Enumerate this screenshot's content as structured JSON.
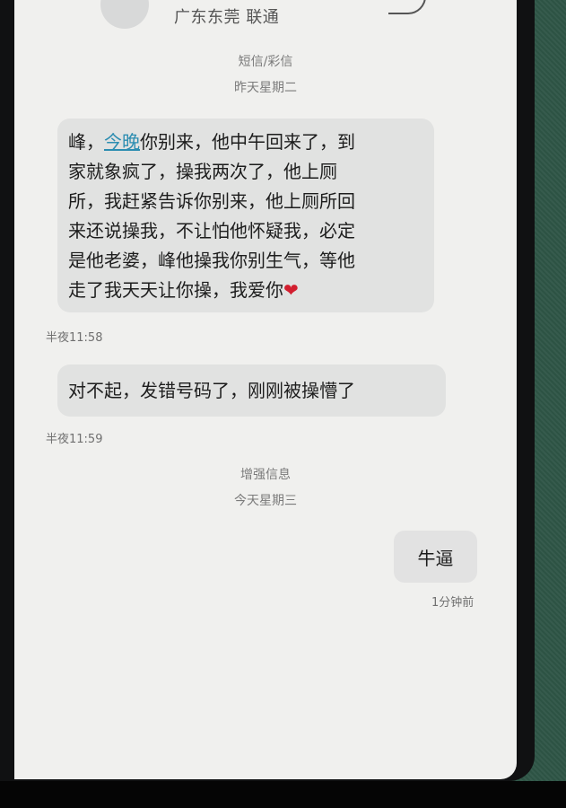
{
  "header": {
    "contact_title": "广东东莞 联通"
  },
  "thread_meta": {
    "message_type": "短信/彩信",
    "date_yesterday": "昨天星期二",
    "enhanced_label": "增强信息",
    "date_today": "今天星期三"
  },
  "messages": [
    {
      "lines": [
        [
          "峰，",
          "今晚",
          "你别来，他中午回来了，到"
        ],
        "家就象疯了，操我两次了，他上厕",
        "所，我赶紧告诉你别来，他上厕所回",
        "来还说操我，不让怕他怀疑我，必定",
        "是他老婆，峰他操我你别生气，等他",
        [
          "走了我天天让你操，我爱你",
          "❤"
        ]
      ],
      "time": "半夜11:58"
    },
    {
      "text": "对不起，发错号码了，刚刚被操懵了",
      "time": "半夜11:59"
    },
    {
      "text": "牛逼",
      "time": "1分钟前"
    }
  ],
  "colors": {
    "link": "#2c8db1",
    "heart": "#d21f2f",
    "bubble": "#e1e2e1",
    "screen": "#f0f0ee"
  }
}
